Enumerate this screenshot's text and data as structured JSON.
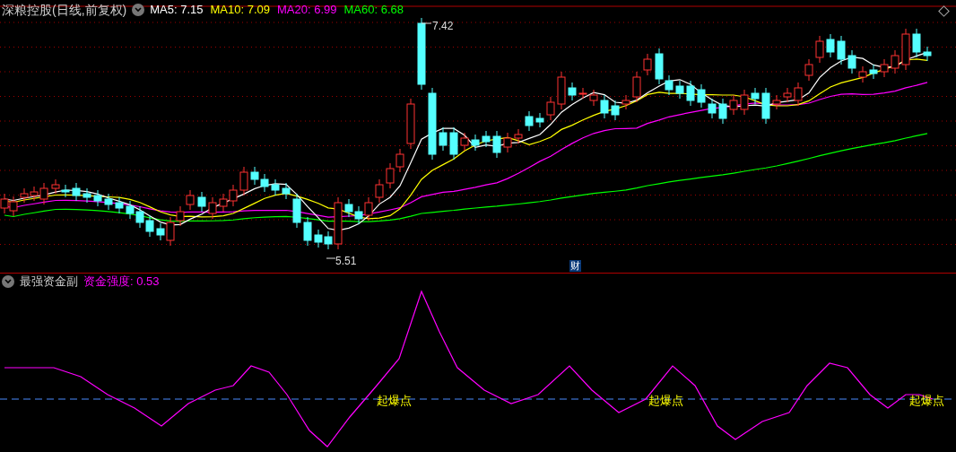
{
  "main_panel": {
    "title": "深粮控股(日线,前复权)",
    "legend": [
      {
        "label": "MA5:",
        "value": "7.15",
        "color": "#ffffff"
      },
      {
        "label": "MA10:",
        "value": "7.09",
        "color": "#ffff00"
      },
      {
        "label": "MA20:",
        "value": "6.99",
        "color": "#ff00ff"
      },
      {
        "label": "MA60:",
        "value": "6.68",
        "color": "#00ff00"
      }
    ],
    "high_label": "7.42",
    "low_label": "5.51",
    "badge": "财"
  },
  "indicator_panel": {
    "title": "最强资金副",
    "legend": [
      {
        "label": "资金强度:",
        "value": "0.53",
        "color": "#ff00ff"
      }
    ],
    "markers": [
      "起爆点",
      "起爆点",
      "起爆点"
    ]
  }
}
